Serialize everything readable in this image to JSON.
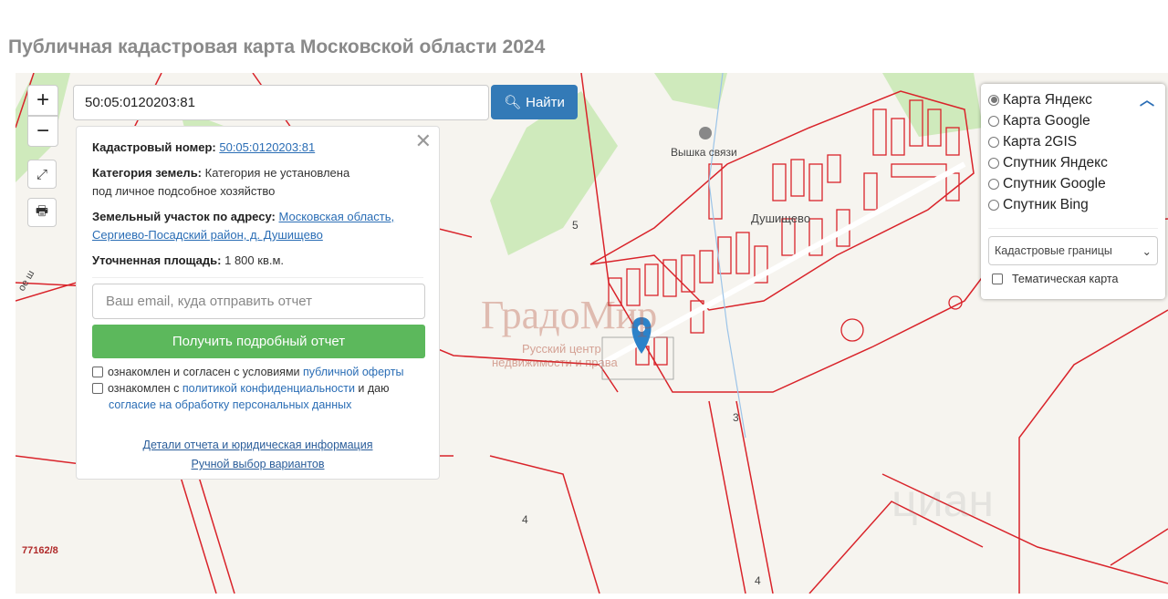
{
  "page_title": "Публичная кадастровая карта Московской области 2024",
  "map": {
    "zoom_in": "+",
    "zoom_out": "−",
    "search_value": "50:05:0120203:81",
    "find_label": "Найти",
    "labels": {
      "tower": "Вышка связи",
      "village": "Душищево",
      "n5": "5",
      "n3": "3",
      "n4a": "4",
      "n4b": "4",
      "parcel": "77162/8",
      "road": "ое ш"
    },
    "watermarks": {
      "gradomir": "ГрадоМир",
      "gradomir_sub1": "Русский центр",
      "gradomir_sub2": "недвижимости и права",
      "cian": "циан"
    },
    "colors": {
      "boundary": "#d9232a",
      "green": "#c9e8b4",
      "accent": "#337ab7",
      "button_green": "#5cb85c"
    }
  },
  "info": {
    "cad_label": "Кадастровый номер:",
    "cad_value": "50:05:0120203:81",
    "cat_label": "Категория земель:",
    "cat_value1": "Категория не установлена",
    "cat_value2": "под личное подсобное хозяйство",
    "addr_label": "Земельный участок по адресу:",
    "addr_value1": "Московская область,",
    "addr_value2": "Сергиево-Посадский район, д. Душищево",
    "area_label": "Уточненная площадь:",
    "area_value": "1 800 кв.м.",
    "email_placeholder": "Ваш email, куда отправить отчет",
    "report_button": "Получить подробный отчет",
    "agree1_text": "ознакомлен и согласен с условиями ",
    "agree1_link": "публичной оферты",
    "agree2_text": "ознакомлен с ",
    "agree2_link": "политикой конфиденциальности",
    "agree2_text2": " и даю",
    "agree2_link2": "согласие на обработку персональных данных",
    "details_link": "Детали отчета и юридическая информация",
    "manual_link": "Ручной выбор вариантов"
  },
  "layers": {
    "options": [
      "Карта Яндекс",
      "Карта Google",
      "Карта 2GIS",
      "Спутник Яндекс",
      "Спутник Google",
      "Спутник Bing"
    ],
    "selected": "Карта Яндекс",
    "overlay_select": "Кадастровые границы",
    "thematic_label": "Тематическая карта",
    "thematic_checked": false
  }
}
